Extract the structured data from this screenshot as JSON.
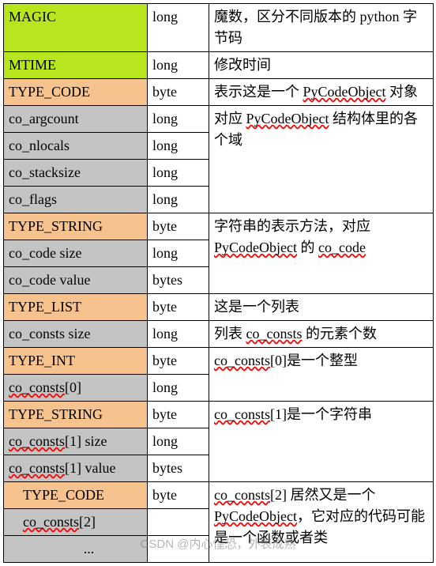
{
  "rows": [
    {
      "name": "MAGIC",
      "type": "long",
      "desc_pre": "魔数，区分不同版本的 python 字节码",
      "bg": "lime"
    },
    {
      "name": "MTIME",
      "type": "long",
      "desc_pre": "修改时间",
      "bg": "lime"
    },
    {
      "name": "TYPE_CODE",
      "type": "byte",
      "desc_pre": "表示这是一个 ",
      "squig": "PyCodeObject",
      "desc_post": " 对象",
      "bg": "orange"
    },
    {
      "name": "co_argcount",
      "type": "long",
      "desc_pre": "对应 ",
      "squig": "PyCodeObject",
      "desc_post": " 结构体里的各个域",
      "bg": "gray",
      "rowspan": 4
    },
    {
      "name": "co_nlocals",
      "type": "long",
      "bg": "gray"
    },
    {
      "name": "co_stacksize",
      "type": "long",
      "bg": "gray"
    },
    {
      "name": "co_flags",
      "type": "long",
      "bg": "gray"
    },
    {
      "name": "TYPE_STRING",
      "type": "byte",
      "desc_pre": "字符串的表示方法，对应 ",
      "squig": "PyCodeObject",
      "desc_post": " 的 ",
      "squig2": "co_code",
      "bg": "orange",
      "rowspan": 3
    },
    {
      "name": "co_code size",
      "type": "long",
      "bg": "gray"
    },
    {
      "name": "co_code value",
      "type": "bytes",
      "bg": "gray"
    },
    {
      "name": "TYPE_LIST",
      "type": "byte",
      "desc_pre": "这是一个列表",
      "bg": "orange"
    },
    {
      "name": "co_consts size",
      "type": "long",
      "desc_pre": "列表 ",
      "squig": "co_consts",
      "desc_post": " 的元素个数",
      "bg": "gray"
    },
    {
      "name": "TYPE_INT",
      "type": "byte",
      "desc_pre": "",
      "squig": "co_consts",
      "desc_post": "[0]是一个整型",
      "bg": "orange",
      "rowspan": 2
    },
    {
      "name": "co_consts[0]",
      "squigName": true,
      "type": "long",
      "bg": "gray"
    },
    {
      "name": "TYPE_STRING",
      "type": "byte",
      "desc_pre": "",
      "squig": "co_consts",
      "desc_post": "[1]是一个字符串",
      "bg": "orange",
      "rowspan": 3
    },
    {
      "name": "co_consts[1] size",
      "squigName": true,
      "type": "long",
      "bg": "gray"
    },
    {
      "name": "co_consts[1] value",
      "squigName": true,
      "type": "bytes",
      "bg": "gray"
    },
    {
      "name": "TYPE_CODE",
      "type": "byte",
      "desc_pre": "",
      "squig": "co_consts",
      "desc_post": "[2] 居然又是一个 ",
      "squig2": "PyCodeObject",
      "desc_post2": "，它对应的代码可能是一个函数或者类",
      "bg": "orange",
      "indent": 1,
      "rowspan": 3
    },
    {
      "name": "co_consts[2]",
      "squigName": true,
      "type": "",
      "bg": "gray",
      "indent": 1
    },
    {
      "name": "...",
      "type": "",
      "bg": "gray",
      "indent": 2
    }
  ],
  "watermark": "CSDN @内心惶恐，外表成熟"
}
